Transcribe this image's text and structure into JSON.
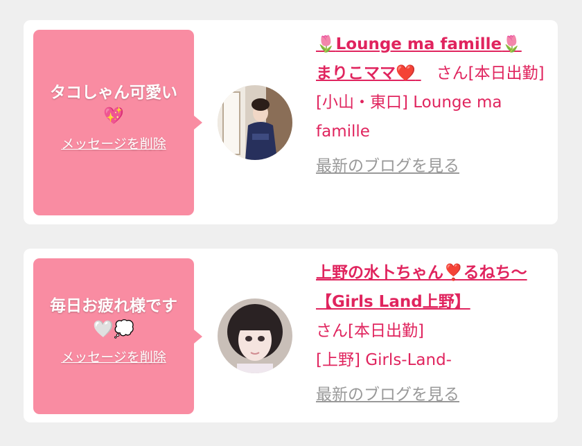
{
  "cards": [
    {
      "message": "タコしゃん可愛い",
      "message_emoji": "💖",
      "delete_label": "メッセージを削除",
      "name_prefix_emoji": "🌷",
      "name_line1": "Lounge ma famille",
      "name_suffix_emoji": "🌷",
      "name_line2": "まりこママ",
      "name_line2_emoji": "❤️",
      "san": "さん",
      "status": "[本日出勤]",
      "area": "[小山・東口] Lounge ma famille",
      "blog_label": "最新のブログを見る"
    },
    {
      "message": "毎日お疲れ様です",
      "message_emoji": "🤍💭",
      "delete_label": "メッセージを削除",
      "name_line1": "上野の水卜ちゃん❣️るねち〜【Girls Land上野】",
      "san": "さん",
      "status": "[本日出勤]",
      "area": "[上野] Girls-Land-",
      "blog_label": "最新のブログを見る"
    }
  ],
  "colors": {
    "bubble": "#f98ca2",
    "accent": "#e0245e",
    "link_gray": "#999999",
    "background": "#efefef"
  }
}
